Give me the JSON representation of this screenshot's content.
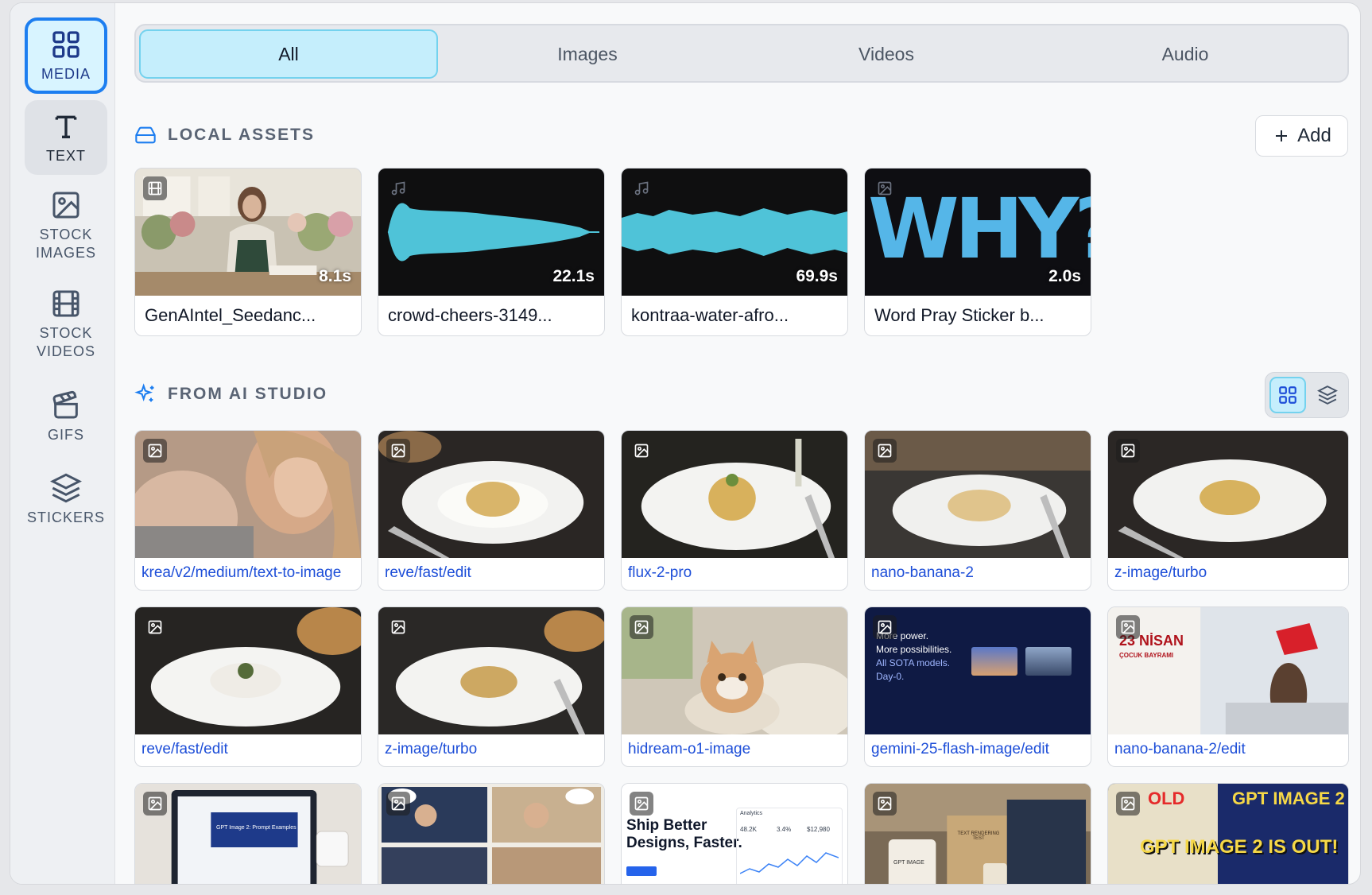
{
  "sidebar": {
    "items": [
      {
        "label": "MEDIA",
        "icon": "grid-icon"
      },
      {
        "label": "TEXT",
        "icon": "text-icon"
      },
      {
        "label_line1": "STOCK",
        "label_line2": "IMAGES",
        "icon": "image-icon"
      },
      {
        "label_line1": "STOCK",
        "label_line2": "VIDEOS",
        "icon": "film-icon"
      },
      {
        "label": "GIFS",
        "icon": "clapperboard-icon"
      },
      {
        "label": "STICKERS",
        "icon": "layers-icon"
      }
    ]
  },
  "tabs": [
    {
      "label": "All",
      "active": true
    },
    {
      "label": "Images"
    },
    {
      "label": "Videos"
    },
    {
      "label": "Audio"
    }
  ],
  "local_assets": {
    "heading": "LOCAL ASSETS",
    "add_label": "Add",
    "items": [
      {
        "title": "GenAIntel_Seedanc...",
        "duration": "8.1s",
        "type": "video"
      },
      {
        "title": "crowd-cheers-3149...",
        "duration": "22.1s",
        "type": "audio"
      },
      {
        "title": "kontraa-water-afro...",
        "duration": "69.9s",
        "type": "audio"
      },
      {
        "title": "Word Pray Sticker b...",
        "duration": "2.0s",
        "type": "image",
        "art_text": "WHY?"
      }
    ]
  },
  "ai_studio": {
    "heading": "FROM AI STUDIO",
    "items": [
      {
        "title": "krea/v2/medium/text-to-image"
      },
      {
        "title": "reve/fast/edit"
      },
      {
        "title": "flux-2-pro"
      },
      {
        "title": "nano-banana-2"
      },
      {
        "title": "z-image/turbo"
      },
      {
        "title": "reve/fast/edit"
      },
      {
        "title": "z-image/turbo"
      },
      {
        "title": "hidream-o1-image"
      },
      {
        "title": "gemini-25-flash-image/edit",
        "art_lines": [
          "More power.",
          "More possibilities.",
          "All SOTA models.",
          "Day-0."
        ]
      },
      {
        "title": "nano-banana-2/edit",
        "art_lines": [
          "23 NİSAN",
          "ÇOCUK BAYRAMI"
        ]
      },
      {
        "title": "",
        "art_lines": [
          "GPT Image 2: Prompt Examples"
        ]
      },
      {
        "title": ""
      },
      {
        "title": "",
        "art_lines": [
          "Ship Better",
          "Designs, Faster.",
          "Analytics",
          "48.2K",
          "3.4%",
          "$12,980"
        ]
      },
      {
        "title": "",
        "art_lines": [
          "GPT IMAGE",
          "TEXT RENDERING TEST"
        ]
      },
      {
        "title": "",
        "art_lines": [
          "OLD",
          "GPT IMAGE 2",
          "GPT IMAGE 2 IS OUT!"
        ]
      }
    ]
  },
  "colors": {
    "accent": "#1d7ef0",
    "tab_active": "#c5eefc",
    "link": "#1d4ed8",
    "waveform": "#4fc3d8"
  }
}
